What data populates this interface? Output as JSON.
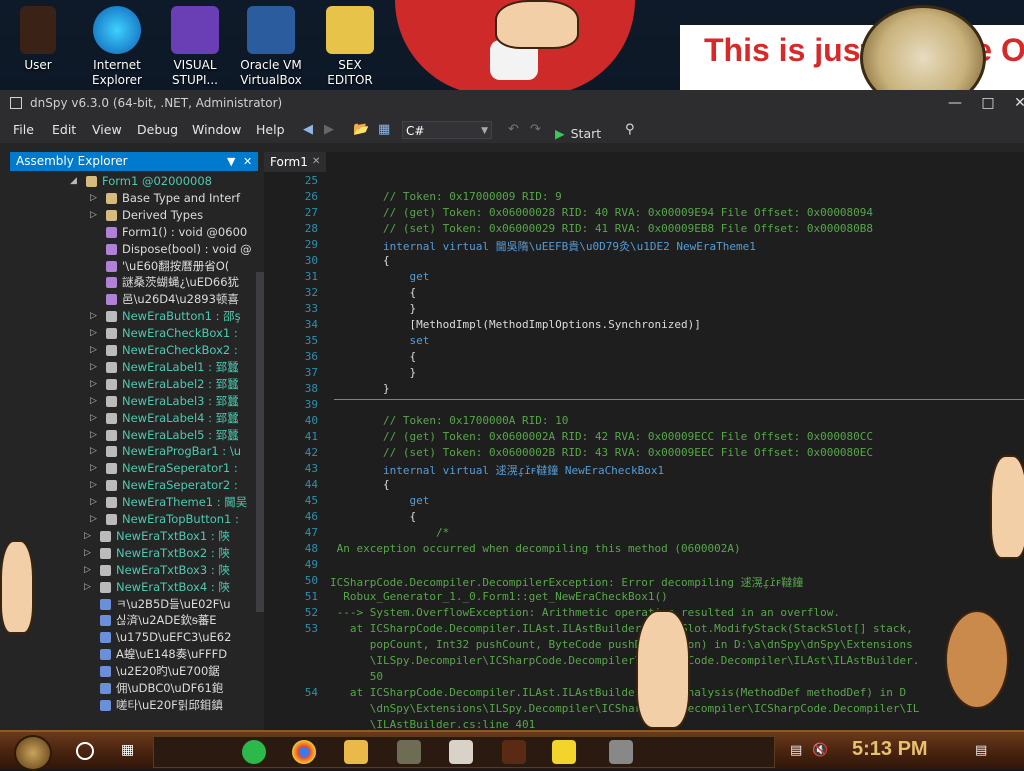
{
  "desktop": {
    "icons": [
      {
        "label": "User"
      },
      {
        "label": "Internet Explorer"
      },
      {
        "label": "VISUAL STUPI..."
      },
      {
        "label": "Oracle VM VirtualBox"
      },
      {
        "label": "SEX EDITOR"
      }
    ],
    "banner_text": "This is just George Ou"
  },
  "window": {
    "title": "dnSpy v6.3.0 (64-bit, .NET, Administrator)",
    "menus": [
      "File",
      "Edit",
      "View",
      "Debug",
      "Window",
      "Help"
    ],
    "language": "C#",
    "start_label": "Start"
  },
  "explorer": {
    "title": "Assembly Explorer",
    "rows": [
      {
        "text": "Form1 @02000008",
        "kind": "class"
      },
      {
        "text": "Base Type and Interf",
        "kind": "folder"
      },
      {
        "text": "Derived Types",
        "kind": "folder"
      },
      {
        "text": "Form1() : void @0600",
        "kind": "method"
      },
      {
        "text": "Dispose(bool) : void @",
        "kind": "method"
      },
      {
        "text": "'\\uE60翻按曆册省O(",
        "kind": "method"
      },
      {
        "text": "謎桑茨蝴蝇¿\\uED66犹",
        "kind": "method"
      },
      {
        "text": "邑\\u26D4\\u2893顿喜",
        "kind": "method"
      },
      {
        "text": "NewEraButton1 : 邵ş",
        "kind": "prop"
      },
      {
        "text": "NewEraCheckBox1 : ",
        "kind": "prop"
      },
      {
        "text": "NewEraCheckBox2 : ",
        "kind": "prop"
      },
      {
        "text": "NewEraLabel1 : 郅蠶",
        "kind": "prop"
      },
      {
        "text": "NewEraLabel2 : 郅蠶",
        "kind": "prop"
      },
      {
        "text": "NewEraLabel3 : 郅蠶",
        "kind": "prop"
      },
      {
        "text": "NewEraLabel4 : 郅蠶",
        "kind": "prop"
      },
      {
        "text": "NewEraLabel5 : 郅蠶",
        "kind": "prop"
      },
      {
        "text": "NewEraProgBar1 : \\u",
        "kind": "prop"
      },
      {
        "text": "NewEraSeperator1 : ",
        "kind": "prop"
      },
      {
        "text": "NewEraSeperator2 : ",
        "kind": "prop"
      },
      {
        "text": "NewEraTheme1 : 閫吴",
        "kind": "prop"
      },
      {
        "text": "NewEraTopButton1 : ",
        "kind": "prop"
      },
      {
        "text": "NewEraTxtBox1 : 陝",
        "kind": "prop"
      },
      {
        "text": "NewEraTxtBox2 : 陝",
        "kind": "prop"
      },
      {
        "text": "NewEraTxtBox3 : 陝",
        "kind": "prop"
      },
      {
        "text": "NewEraTxtBox4 : 陝",
        "kind": "prop"
      },
      {
        "text": "ㅋ\\u2B5D들\\uE02F\\u",
        "kind": "field"
      },
      {
        "text": "싢済\\u2ADE欽ᵴ蕃E",
        "kind": "field"
      },
      {
        "text": "\\u175D\\uEFC3\\uE62",
        "kind": "field"
      },
      {
        "text": "A蝗\\uE148奏\\uFFFD",
        "kind": "field"
      },
      {
        "text": "\\u2E20旳\\uE700鋸",
        "kind": "field"
      },
      {
        "text": "佣\\uDBC0\\uDF61鉋",
        "kind": "field"
      },
      {
        "text": "嗟타\\uE20F릵邱鉬鎮",
        "kind": "field"
      }
    ]
  },
  "editor": {
    "tab_label": "Form1",
    "lines": [
      {
        "n": "25",
        "text": "",
        "cls": ""
      },
      {
        "n": "26",
        "text": "        // Token: 0x17000009 RID: 9",
        "cls": "comment"
      },
      {
        "n": "27",
        "text": "        // (get) Token: 0x06000028 RID: 40 RVA: 0x00009E94 File Offset: 0x00008094",
        "cls": "comment"
      },
      {
        "n": "28",
        "text": "        // (set) Token: 0x06000029 RID: 41 RVA: 0x00009EB8 File Offset: 0x000080B8",
        "cls": "comment"
      },
      {
        "n": "29",
        "text": "        internal virtual 閫吳隋\\uEEFB貴\\u0D79灸\\u1DE2 NewEraTheme1",
        "cls": "kw"
      },
      {
        "n": "30",
        "text": "        {",
        "cls": ""
      },
      {
        "n": "31",
        "text": "            get",
        "cls": "kw"
      },
      {
        "n": "32",
        "text": "            {",
        "cls": ""
      },
      {
        "n": "33",
        "text": "            }",
        "cls": ""
      },
      {
        "n": "34",
        "text": "            [MethodImpl(MethodImplOptions.Synchronized)]",
        "cls": ""
      },
      {
        "n": "35",
        "text": "            set",
        "cls": "kw"
      },
      {
        "n": "36",
        "text": "            {",
        "cls": ""
      },
      {
        "n": "37",
        "text": "            }",
        "cls": ""
      },
      {
        "n": "38",
        "text": "        }",
        "cls": ""
      },
      {
        "n": "39",
        "text": "",
        "cls": ""
      },
      {
        "n": "40",
        "text": "        // Token: 0x1700000A RID: 10",
        "cls": "comment"
      },
      {
        "n": "41",
        "text": "        // (get) Token: 0x0600002A RID: 42 RVA: 0x00009ECC File Offset: 0x000080CC",
        "cls": "comment"
      },
      {
        "n": "42",
        "text": "        // (set) Token: 0x0600002B RID: 43 RVA: 0x00009EEC File Offset: 0x000080EC",
        "cls": "comment"
      },
      {
        "n": "43",
        "text": "        internal virtual 逑滉ɾ̬ɾ̌ꜰ韃鐘 NewEraCheckBox1",
        "cls": "kw"
      },
      {
        "n": "44",
        "text": "        {",
        "cls": ""
      },
      {
        "n": "45",
        "text": "            get",
        "cls": "kw"
      },
      {
        "n": "46",
        "text": "            {",
        "cls": ""
      },
      {
        "n": "47",
        "text": "                /*",
        "cls": "comment"
      },
      {
        "n": "48",
        "text": " An exception occurred when decompiling this method (0600002A)",
        "cls": "comment"
      },
      {
        "n": "49",
        "text": "",
        "cls": ""
      },
      {
        "n": "50",
        "text": "ICSharpCode.Decompiler.DecompilerException: Error decompiling 逑滉ɾ̬ɾ̌ꜰ韃鐘",
        "cls": "comment"
      },
      {
        "n": "51",
        "text": "  Robux_Generator_1._0.Form1::get_NewEraCheckBox1()",
        "cls": "comment"
      },
      {
        "n": "52",
        "text": " ---> System.OverflowException: Arithmetic operation resulted in an overflow.",
        "cls": "comment"
      },
      {
        "n": "53",
        "text": "   at ICSharpCode.Decompiler.ILAst.ILAstBuilder.StackSlot.ModifyStack(StackSlot[] stack,",
        "cls": "comment"
      },
      {
        "n": "",
        "text": "      popCount, Int32 pushCount, ByteCode pushDefinition) in D:\\a\\dnSpy\\dnSpy\\Extensions",
        "cls": "comment"
      },
      {
        "n": "",
        "text": "      \\ILSpy.Decompiler\\ICSharpCode.Decompiler\\ICSharpCode.Decompiler\\ILAst\\ILAstBuilder.",
        "cls": "comment"
      },
      {
        "n": "",
        "text": "      50",
        "cls": "comment"
      },
      {
        "n": "54",
        "text": "   at ICSharpCode.Decompiler.ILAst.ILAstBuilder.StackAnalysis(MethodDef methodDef) in D",
        "cls": "comment"
      },
      {
        "n": "",
        "text": "      \\dnSpy\\Extensions\\ILSpy.Decompiler\\ICSharpCode.Decompiler\\ICSharpCode.Decompiler\\IL",
        "cls": "comment"
      },
      {
        "n": "",
        "text": "      \\ILAstBuilder.cs:line 401",
        "cls": "comment"
      }
    ]
  },
  "taskbar": {
    "clock": "5:13 PM"
  }
}
